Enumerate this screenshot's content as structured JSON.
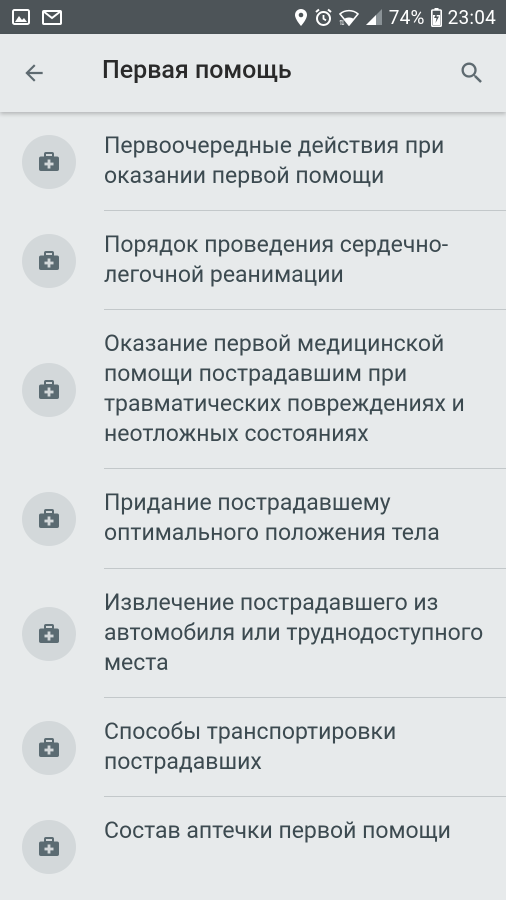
{
  "status_bar": {
    "battery": "74%",
    "time": "23:04",
    "left_icons": [
      "gallery-icon",
      "mail-icon"
    ],
    "right_icons": [
      "location-icon",
      "alarm-icon",
      "wifi-icon",
      "signal-icon",
      "battery-charging-icon"
    ]
  },
  "app_bar": {
    "title": "Первая помощь",
    "back_icon": "arrow-left-icon",
    "search_icon": "search-icon"
  },
  "items": [
    {
      "label": "Первоочередные действия при оказании первой помощи",
      "icon": "first-aid-kit-icon"
    },
    {
      "label": "Порядок проведения сердечно-легочной реанимации",
      "icon": "first-aid-kit-icon"
    },
    {
      "label": "Оказание первой медицинской помощи пострадавшим при травматических повреждениях и неотложных состояниях",
      "icon": "first-aid-kit-icon"
    },
    {
      "label": "Придание пострадавшему оптимального положения тела",
      "icon": "first-aid-kit-icon"
    },
    {
      "label": "Извлечение пострадавшего из автомобиля или труднодоступного места",
      "icon": "first-aid-kit-icon"
    },
    {
      "label": "Способы транспортировки пострадавших",
      "icon": "first-aid-kit-icon"
    },
    {
      "label": "Состав аптечки первой помощи",
      "icon": "first-aid-kit-icon"
    }
  ],
  "colors": {
    "status_bar_bg": "#4d5458",
    "background": "#e7eaeb",
    "text": "#3c4a50",
    "icon_circle": "#d3d8da",
    "icon": "#5b6b72"
  }
}
